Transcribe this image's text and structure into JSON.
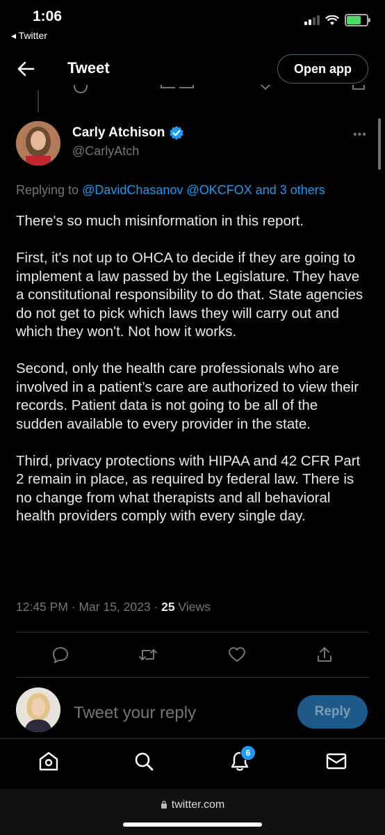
{
  "status_bar": {
    "time": "1:06",
    "back_app": "◂ Twitter"
  },
  "header": {
    "title": "Tweet",
    "open_app_label": "Open app"
  },
  "tweet": {
    "author_name": "Carly Atchison",
    "author_handle": "@CarlyAtch",
    "verified": true,
    "replying_prefix": "Replying to",
    "replying_users": "@DavidChasanov @OKCFOX and 3 others",
    "paragraphs": [
      "There's so much misinformation in this report.",
      "First, it's not up to OHCA to decide if they are going to implement a law passed by the Legislature. They have a constitutional responsibility to do that. State agencies do not get to pick which laws they will carry out and which they won't. Not how it works.",
      "Second, only the health care professionals who are involved in a patient’s care are authorized to view their records. Patient data is not going to be all of the sudden available to every provider in the state.",
      "Third, privacy protections with HIPAA and 42 CFR Part 2 remain in place, as required by federal law. There is no change from what therapists and all behavioral health providers comply with every single day."
    ],
    "timestamp": "12:45 PM · Mar 15, 2023 · ",
    "views_count": "25",
    "views_label": "Views"
  },
  "reply_box": {
    "placeholder": "Tweet your reply",
    "button_label": "Reply"
  },
  "tab_bar": {
    "notification_count": "6"
  },
  "browser": {
    "url": "twitter.com"
  },
  "colors": {
    "accent": "#1d9bf0",
    "background": "#000000",
    "secondary_text": "#71767b"
  }
}
